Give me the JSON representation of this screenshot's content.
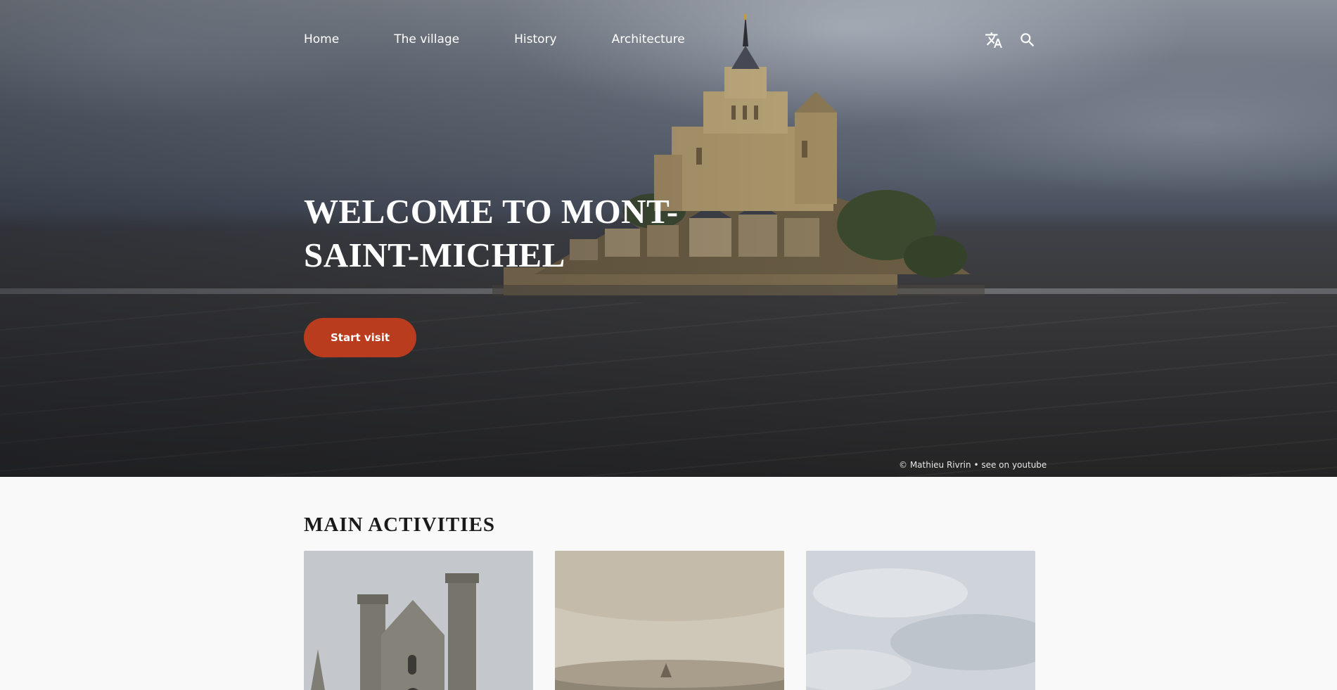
{
  "nav": {
    "items": [
      {
        "label": "Home"
      },
      {
        "label": "The village"
      },
      {
        "label": "History"
      },
      {
        "label": "Architecture"
      }
    ],
    "translate_icon": "translate-icon",
    "search_icon": "search-icon"
  },
  "hero": {
    "title": "WELCOME TO MONT-SAINT-MICHEL",
    "cta_label": "Start visit",
    "credit": {
      "author": "© Mathieu Rivrin",
      "separator": " • ",
      "link": "see on youtube"
    }
  },
  "section": {
    "title": "MAIN ACTIVITIES",
    "cards": [
      {
        "image": "abbey-towers-photo"
      },
      {
        "image": "bay-landscape-photo"
      },
      {
        "image": "cloudy-sky-photo"
      }
    ]
  },
  "colors": {
    "accent": "#b93c1e",
    "page_background": "#f9f9f9",
    "text": "#1a1a1a"
  }
}
